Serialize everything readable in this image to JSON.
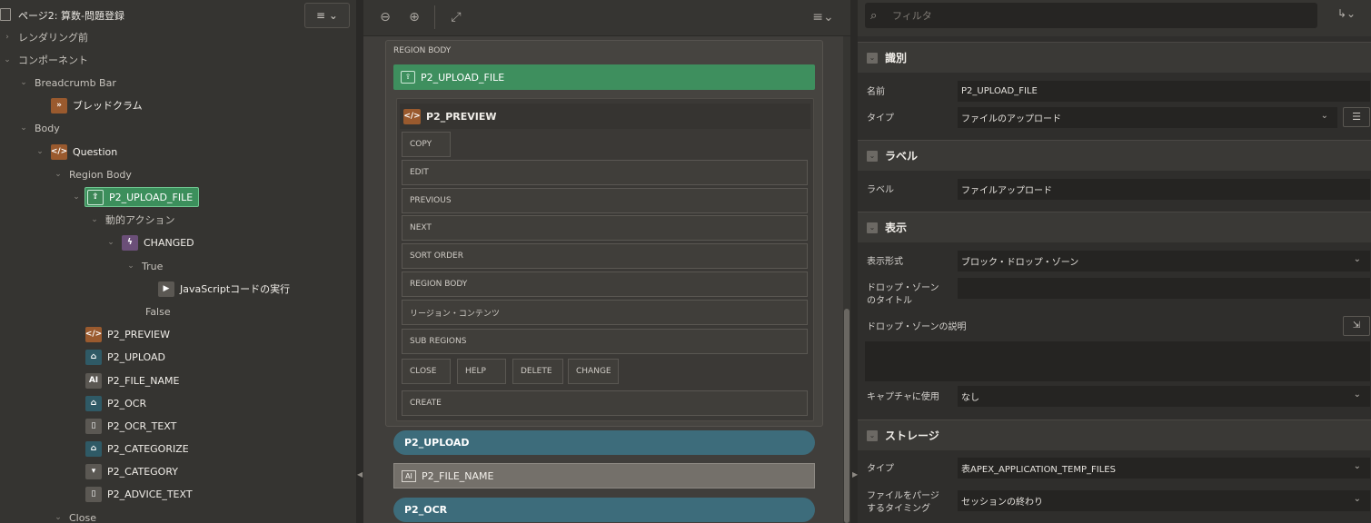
{
  "tree": {
    "page_title": "ページ2: 算数-問題登録",
    "menu_icon": "menu-icon",
    "nodes": [
      {
        "label": "レンダリング前"
      },
      {
        "label": "コンポーネント"
      },
      {
        "label": "Breadcrumb Bar"
      },
      {
        "label": "ブレッドクラム"
      },
      {
        "label": "Body"
      },
      {
        "label": "Question"
      },
      {
        "label": "Region Body"
      },
      {
        "label": "P2_UPLOAD_FILE"
      },
      {
        "label": "動的アクション"
      },
      {
        "label": "CHANGED"
      },
      {
        "label": "True"
      },
      {
        "label": "JavaScriptコードの実行"
      },
      {
        "label": "False"
      },
      {
        "label": "P2_PREVIEW"
      },
      {
        "label": "P2_UPLOAD"
      },
      {
        "label": "P2_FILE_NAME"
      },
      {
        "label": "P2_OCR"
      },
      {
        "label": "P2_OCR_TEXT"
      },
      {
        "label": "P2_CATEGORIZE"
      },
      {
        "label": "P2_CATEGORY"
      },
      {
        "label": "P2_ADVICE_TEXT"
      },
      {
        "label": "Close"
      }
    ]
  },
  "layout": {
    "region_caption": "REGION BODY",
    "upload_file_item": "P2_UPLOAD_FILE",
    "preview_title": "P2_PREVIEW",
    "slots": {
      "copy": "COPY",
      "edit": "EDIT",
      "previous": "PREVIOUS",
      "next": "NEXT",
      "sort_order": "SORT ORDER",
      "region_body": "REGION BODY",
      "region_contents": "リージョン・コンテンツ",
      "sub_regions": "SUB REGIONS",
      "close": "CLOSE",
      "help": "HELP",
      "delete": "DELETE",
      "change": "CHANGE",
      "create": "CREATE"
    },
    "upload_button": "P2_UPLOAD",
    "file_name_item": "P2_FILE_NAME",
    "ocr_button": "P2_OCR"
  },
  "properties": {
    "filter_placeholder": "フィルタ",
    "groups": {
      "identification": {
        "title": "識別",
        "name_label": "名前",
        "name_value": "P2_UPLOAD_FILE",
        "type_label": "タイプ",
        "type_value": "ファイルのアップロード"
      },
      "label": {
        "title": "ラベル",
        "label_label": "ラベル",
        "label_value": "ファイルアップロード"
      },
      "display": {
        "title": "表示",
        "display_as_label": "表示形式",
        "display_as_value": "ブロック・ドロップ・ゾーン",
        "dropzone_title_label_1": "ドロップ・ゾーン",
        "dropzone_title_label_2": "のタイトル",
        "dropzone_desc_label": "ドロップ・ゾーンの説明",
        "capture_label": "キャプチャに使用",
        "capture_value": "なし"
      },
      "storage": {
        "title": "ストレージ",
        "type_label": "タイプ",
        "type_value": "表APEX_APPLICATION_TEMP_FILES",
        "purge_label_1": "ファイルをパージ",
        "purge_label_2": "するタイミング",
        "purge_value": "セッションの終わり"
      }
    }
  }
}
